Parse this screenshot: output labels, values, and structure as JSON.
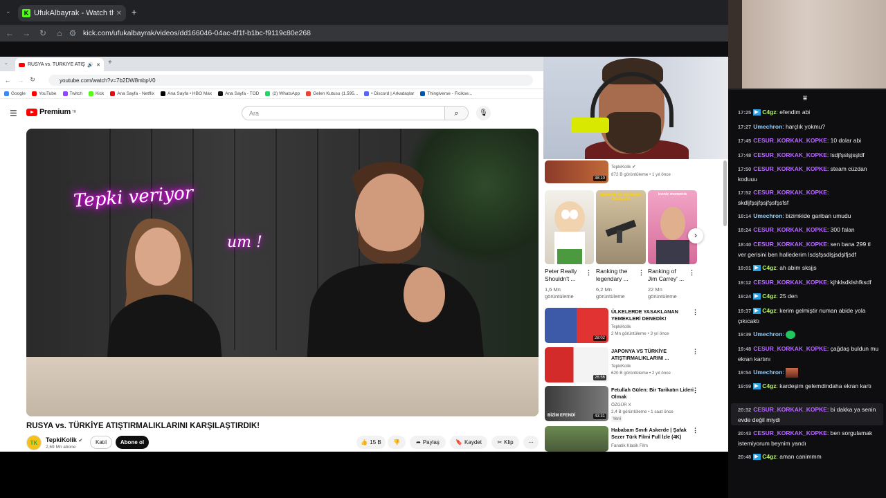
{
  "outer": {
    "tab_title": "UfukAlbayrak - Watch the V",
    "url": "kick.com/ufukalbayrak/videos/dd166046-04ac-4f1f-b1bc-f9119c80e268"
  },
  "inner": {
    "tab_title": "RUSYA vs. TÜRKİYE ATIŞTIR",
    "url": "youtube.com/watch?v=7b2DW8mbpV0",
    "bookmarks": [
      "Google",
      "YouTube",
      "Twitch",
      "Kick",
      "Ana Sayfa - Netflix",
      "Ana Sayfa • HBO Max",
      "Ana Sayfa - TOD",
      "(2) WhatsApp",
      "Gelen Kutusu (1.595...",
      "• Discord | Arkadaşlar",
      "Thingiverse - Ficikse..."
    ],
    "bookmark_colors": [
      "#4285f4",
      "#ff0000",
      "#9146ff",
      "#53fc18",
      "#e50914",
      "#000000",
      "#111111",
      "#25d366",
      "#ea4335",
      "#5865f2",
      "#0055aa"
    ]
  },
  "youtube": {
    "logo": "Premium",
    "logo_region": "TR",
    "search_placeholder": "Ara",
    "neon_text_1": "Tepki veriyor",
    "neon_text_2": "um !",
    "video_title": "RUSYA vs. TÜRKİYE ATIŞTIRMALIKLARINI KARŞILAŞTIRDIK!",
    "channel_avatar": "TK",
    "channel_name": "TepkiKolik",
    "channel_subs": "2,69 Mn abone",
    "join_label": "Katıl",
    "subscribe_label": "Abone ol",
    "likes": "15 B",
    "share_label": "Paylaş",
    "save_label": "Kaydet",
    "clip_label": "Klip"
  },
  "sidebar": {
    "top_item": {
      "channel": "TepkiKolik",
      "meta": "872 B görüntüleme • 1 yıl önce",
      "duration": "38:10"
    },
    "shorts": [
      {
        "title": "Peter Really Shouldn't ...",
        "views": "1,6 Mn görüntüleme"
      },
      {
        "title": "Ranking the legendary ...",
        "views": "6,2 Mn görüntüleme",
        "overlay": "Ranking the legendary OBJECTS"
      },
      {
        "title": "Ranking of Jim Carrey' ...",
        "views": "22 Mn görüntüleme",
        "overlay": "iconic moments"
      }
    ],
    "videos": [
      {
        "title": "ÜLKELERDE YASAKLANAN YEMEKLERİ DENEDİK!",
        "channel": "TepkiKolik",
        "meta": "2 Mn görüntüleme • 3 yıl önce",
        "duration": "28:02"
      },
      {
        "title": "JAPONYA VS TÜRKİYE ATIŞTIRMALIKLARINI ...",
        "channel": "TepkiKolik",
        "meta": "620 B görüntüleme • 2 yıl önce",
        "duration": "26:56"
      },
      {
        "title": "Fetullah Gülen: Bir Tarikatın Lideri Olmak",
        "channel": "ÖZGÜR X",
        "meta": "2,4 B görüntüleme • 1 saat önce",
        "badge": "Yeni",
        "duration": "43:31",
        "overlay": "BİZİM EFENDİ"
      },
      {
        "title": "Hababam Sınıfı Askerde | Şafak Sezer Türk Filmi Full İzle (4K)",
        "channel": "Fanatik Klasik Film",
        "meta": ""
      }
    ]
  },
  "chat": {
    "messages": [
      {
        "time": "17:25",
        "badge": true,
        "user": "C4gz",
        "color": "green",
        "text": "efendim abi"
      },
      {
        "time": "17:27",
        "badge": false,
        "user": "Umechron",
        "color": "blue",
        "text": "harçlık yokmu?"
      },
      {
        "time": "17:45",
        "badge": false,
        "user": "CESUR_KORKAK_KOPKE",
        "color": "purple",
        "text": "10 dolar abi"
      },
      {
        "time": "17:48",
        "badge": false,
        "user": "CESUR_KORKAK_KOPKE",
        "color": "purple",
        "text": "lsdjfşslşjsşldf"
      },
      {
        "time": "17:50",
        "badge": false,
        "user": "CESUR_KORKAK_KOPKE",
        "color": "purple",
        "text": "steam cüzdan koduuu"
      },
      {
        "time": "17:52",
        "badge": false,
        "user": "CESUR_KORKAK_KOPKE",
        "color": "purple",
        "text": "skdljfşsjfşsjfşsfşsfsf"
      },
      {
        "time": "18:14",
        "badge": false,
        "user": "Umechron",
        "color": "blue",
        "text": "bizimkide gariban umudu"
      },
      {
        "time": "18:24",
        "badge": false,
        "user": "CESUR_KORKAK_KOPKE",
        "color": "purple",
        "text": "300 falan"
      },
      {
        "time": "18:40",
        "badge": false,
        "user": "CESUR_KORKAK_KOPKE",
        "color": "purple",
        "text": "sen bana 299 tl ver gerisini ben hallederim lsdşfşsdlşjsdşlfjsdf"
      },
      {
        "time": "19:01",
        "badge": true,
        "user": "C4gz",
        "color": "green",
        "text": "ah abim sksjjs"
      },
      {
        "time": "19:12",
        "badge": false,
        "user": "CESUR_KORKAK_KOPKE",
        "color": "purple",
        "text": "kjhklsdklshfksdf"
      },
      {
        "time": "19:24",
        "badge": true,
        "user": "C4gz",
        "color": "green",
        "text": "25 den"
      },
      {
        "time": "19:37",
        "badge": true,
        "user": "C4gz",
        "color": "green",
        "text": "kerim gelmiştir numan abide yola çıkıcaktı"
      },
      {
        "time": "19:39",
        "badge": false,
        "user": "Umechron",
        "color": "blue",
        "text": "",
        "emote": "green"
      },
      {
        "time": "19:48",
        "badge": false,
        "user": "CESUR_KORKAK_KOPKE",
        "color": "purple",
        "text": "çağdaş buldun mu ekran kartını"
      },
      {
        "time": "19:54",
        "badge": false,
        "user": "Umechron",
        "color": "blue",
        "text": "",
        "emote": "pic"
      },
      {
        "time": "19:59",
        "badge": true,
        "user": "C4gz",
        "color": "green",
        "text": "kardeşim gelemdindaha ekran kartı"
      },
      {
        "time": "20:32",
        "badge": false,
        "user": "CESUR_KORKAK_KOPKE",
        "color": "purple",
        "text": "bi dakka ya senin evde değil miydi"
      },
      {
        "time": "20:43",
        "badge": false,
        "user": "CESUR_KORKAK_KOPKE",
        "color": "purple",
        "text": "ben sorgulamak istemiyorum beynim yandı"
      },
      {
        "time": "20:48",
        "badge": true,
        "user": "C4gz",
        "color": "green",
        "text": "aman canimmm"
      }
    ]
  }
}
